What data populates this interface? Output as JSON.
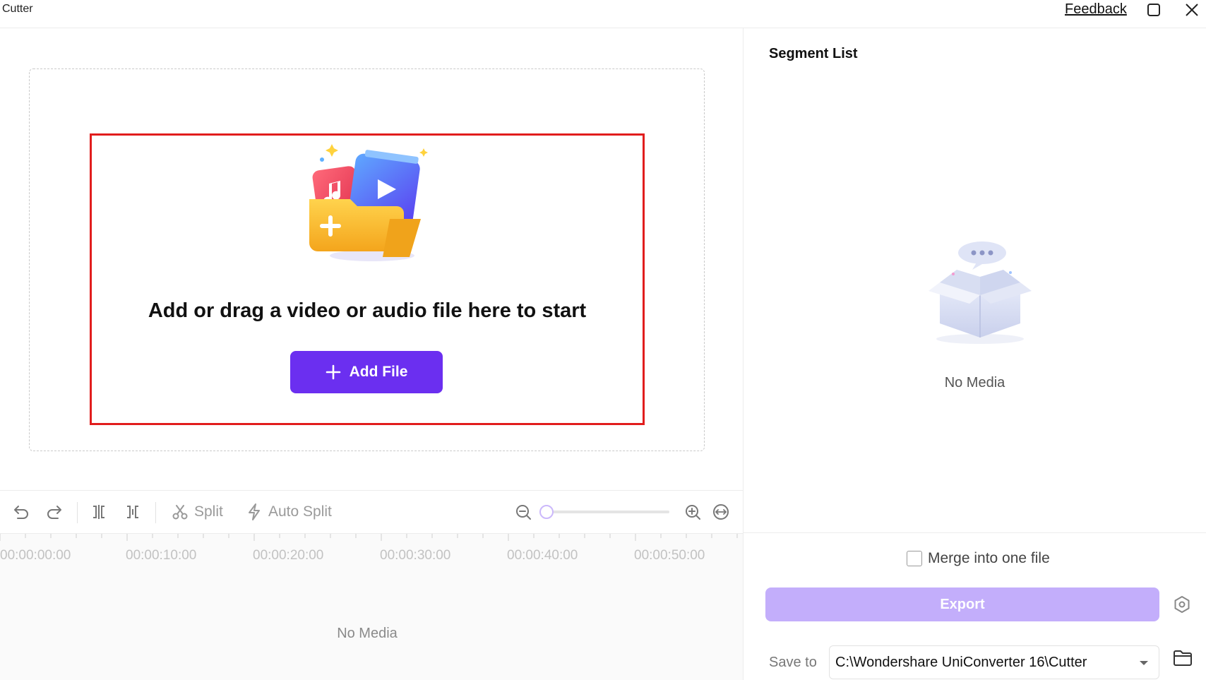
{
  "window": {
    "title": "Cutter",
    "feedback_label": "Feedback"
  },
  "drop_zone": {
    "prompt": "Add or drag a video or audio file here to start",
    "add_file_label": "Add File"
  },
  "toolbar": {
    "split_label": "Split",
    "auto_split_label": "Auto Split",
    "zoom_level": 0
  },
  "timeline": {
    "ticks": [
      "00:00:00:00",
      "00:00:10:00",
      "00:00:20:00",
      "00:00:30:00",
      "00:00:40:00",
      "00:00:50:00"
    ],
    "empty_text": "No Media"
  },
  "segment_list": {
    "title": "Segment List",
    "empty_text": "No Media"
  },
  "export_panel": {
    "merge_label": "Merge into one file",
    "merge_checked": false,
    "export_label": "Export",
    "save_to_label": "Save to",
    "save_path": "C:\\Wondershare UniConverter 16\\Cutter"
  },
  "colors": {
    "accent": "#6b2ff0",
    "export_disabled": "#c3aefb",
    "highlight": "#e11d1d"
  }
}
